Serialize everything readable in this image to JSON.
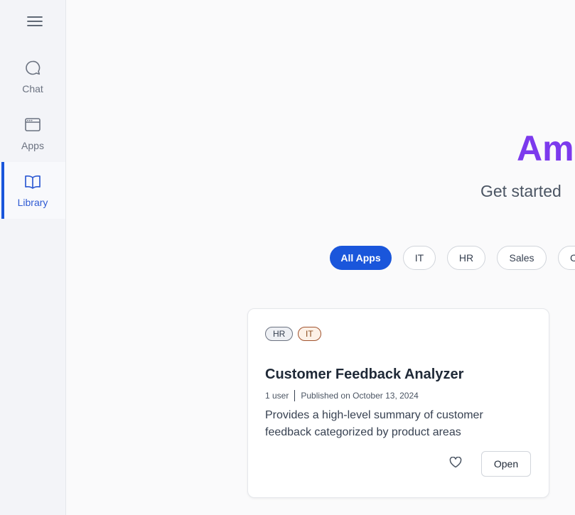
{
  "sidebar": {
    "menu_icon": "hamburger-menu-icon",
    "items": [
      {
        "label": "Chat",
        "icon": "chat-bubble-icon"
      },
      {
        "label": "Apps",
        "icon": "browser-window-icon"
      },
      {
        "label": "Library",
        "icon": "open-book-icon",
        "active": true
      }
    ]
  },
  "hero": {
    "title": "Am",
    "subtitle": "Get started"
  },
  "filters": {
    "all": "All Apps",
    "it": "IT",
    "hr": "HR",
    "sales": "Sales",
    "partial": "C"
  },
  "card": {
    "tags": [
      "HR",
      "IT"
    ],
    "title": "Customer Feedback Analyzer",
    "users": "1 user",
    "published": "Published on October 13, 2024",
    "description": "Provides a high-level summary of customer feedback categorized by product areas",
    "favorite_icon": "heart-icon",
    "open_label": "Open"
  },
  "colors": {
    "accent": "#1a56db",
    "hero_title": "#7c3aed",
    "sidebar_bg": "#f3f4f8"
  }
}
